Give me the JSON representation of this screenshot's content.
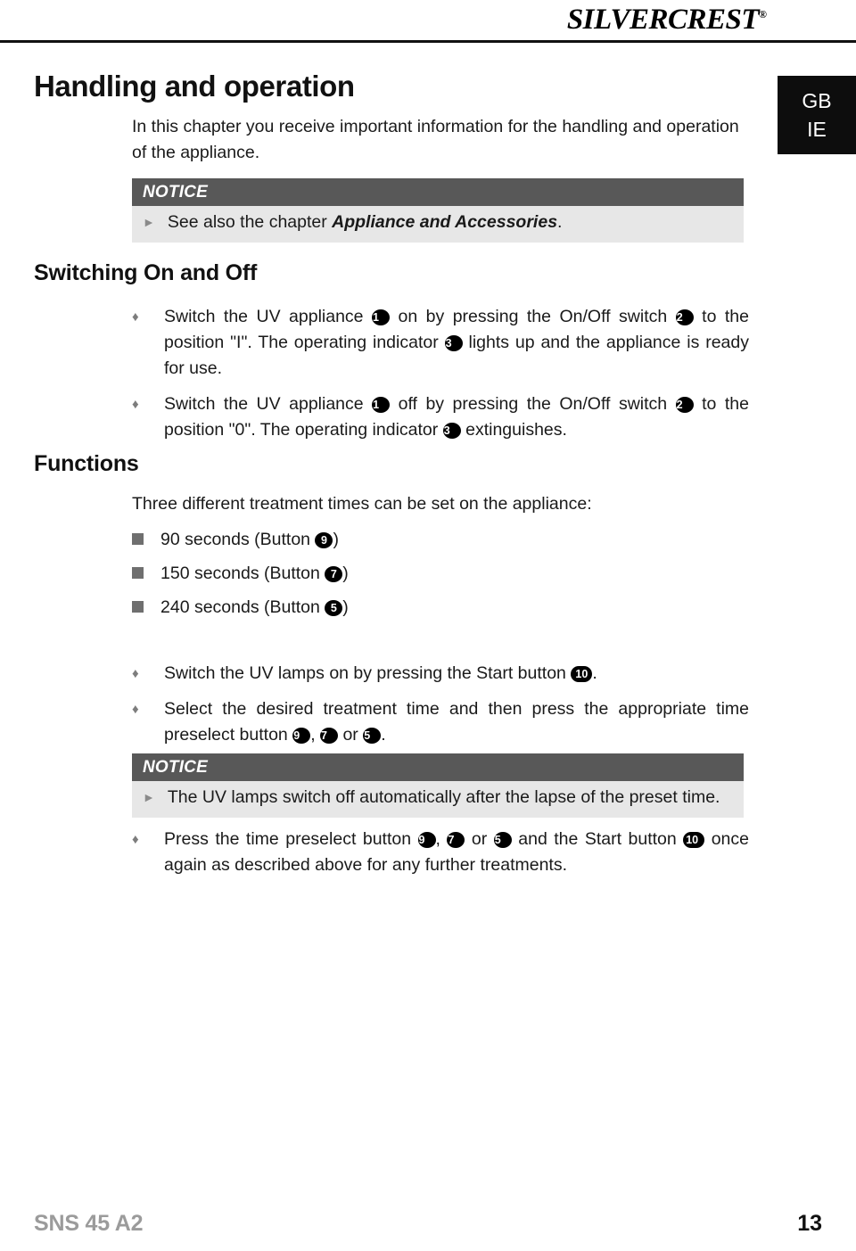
{
  "brand": {
    "logo_text": "SILVERCREST",
    "registered_mark": "®"
  },
  "country_badge": {
    "line1": "GB",
    "line2": "IE"
  },
  "chapter": {
    "title": "Handling and operation",
    "intro": "In this chapter you receive important information for the handling and operation of the appliance."
  },
  "notice_1": {
    "heading": "NOTICE",
    "arrow": "►",
    "text_before": "See also the chapter ",
    "text_bold": "Appliance and Accessories",
    "text_after": "."
  },
  "switching": {
    "title": "Switching On and Off",
    "bullet_mark": "♦",
    "items": [
      {
        "seg1": "Switch the UV appliance ",
        "num1": "1",
        "seg2": " on by pressing the On/Off switch ",
        "num2": "2",
        "seg3": " to the position \"I\". The operating indicator ",
        "num3": "3",
        "seg4": " lights up and the appliance is ready for use."
      },
      {
        "seg1": "Switch the UV appliance ",
        "num1": "1",
        "seg2": " off by pressing the On/Off switch ",
        "num2": "2",
        "seg3": " to the position \"0\". The operating indicator ",
        "num3": "3",
        "seg4": " extinguishes."
      }
    ]
  },
  "functions": {
    "title": "Functions",
    "lead": "Three different treatment times can be set on the appliance:",
    "square_mark": "■",
    "times": [
      {
        "label_before": "90 seconds (Button ",
        "num": "9",
        "label_after": ")"
      },
      {
        "label_before": "150 seconds (Button ",
        "num": "7",
        "label_after": ")"
      },
      {
        "label_before": "240 seconds (Button ",
        "num": "5",
        "label_after": ")"
      }
    ]
  },
  "steps": {
    "bullet_mark": "♦",
    "item1": {
      "seg1": "Switch the UV lamps on by pressing the Start button ",
      "num1": "10",
      "seg2": "."
    },
    "item2": {
      "seg1": "Select the desired treatment time and then press the appropriate time preselect button ",
      "num1": "9",
      "seg2": ", ",
      "num2": "7",
      "seg3": " or ",
      "num3": "5",
      "seg4": "."
    }
  },
  "notice_2": {
    "heading": "NOTICE",
    "arrow": "►",
    "text": "The UV lamps switch off automatically after the lapse of the preset time."
  },
  "final_step": {
    "bullet_mark": "♦",
    "seg1": "Press the time preselect button ",
    "num1": "9",
    "seg2": ", ",
    "num2": "7",
    "seg3": " or ",
    "num3": "5",
    "seg4": " and the Start button ",
    "num4": "10",
    "seg5": " once again as described above for any further treatments."
  },
  "footer": {
    "model": "SNS 45 A2",
    "page_number": "13"
  },
  "colors": {
    "notice_header_bg": "#585858",
    "notice_body_bg": "#e7e7e7",
    "badge_bg": "#0d0d0d",
    "footer_model": "#9b9b9b",
    "square_marker": "#6f6f6f"
  }
}
